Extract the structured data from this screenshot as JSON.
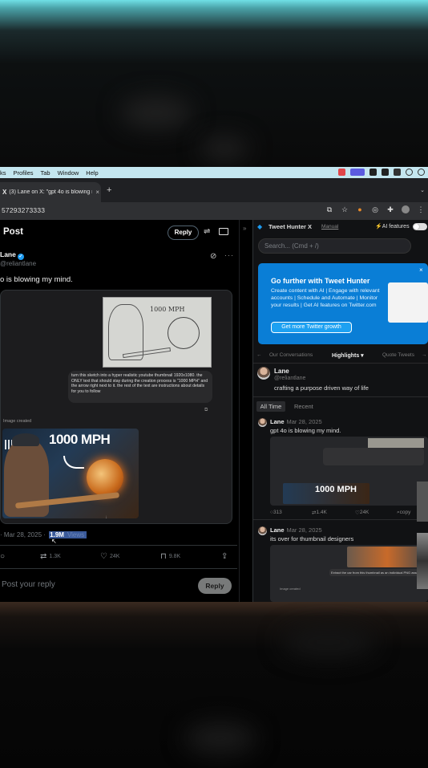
{
  "menubar": {
    "items": [
      "ks",
      "Profiles",
      "Tab",
      "Window",
      "Help"
    ]
  },
  "browser": {
    "tab_title": "(3) Lane on X: \"gpt 4o is blowing my mind\"",
    "tab_close": "×",
    "new_tab": "+",
    "url": "57293273333"
  },
  "post": {
    "header_title": "Post",
    "reply_pill": "Reply",
    "author_name": "Lane",
    "author_handle": "@reliantlane",
    "text": "o is blowing my mind.",
    "sketch_label": "1000 MPH",
    "prompt": "turn this sketch into a hyper realistic youtube thumbnail 1920x1080. the ONLY text that should stay during the creation process is \"1000 MPH\" and the arrow right next to it. the rest of the text are instructions about details for you to follow",
    "image_created": "Image created",
    "image_title": "1000 MPH",
    "date": "· Mar 28, 2025 ·",
    "views": "1.9M",
    "views_label": "Views",
    "actions": {
      "retweets": "1.3K",
      "likes": "24K",
      "bookmarks": "9.8K"
    },
    "reply_placeholder": "Post your reply",
    "reply_button": "Reply"
  },
  "sidebar": {
    "title": "Tweet Hunter X",
    "manual": "Manual",
    "ai_features": "AI features",
    "search_placeholder": "Search... (Cmd + /)",
    "promo": {
      "title": "Go further with Tweet Hunter",
      "text": "Create content with AI | Engage with relevant accounts | Schedule and Automate | Monitor your results | Get AI features on Twitter.com",
      "button": "Get more Twitter growth",
      "close": "×"
    },
    "tabs": [
      "Our Conversations",
      "Highlights ▾",
      "Quote Tweets"
    ],
    "profile": {
      "name": "Lane",
      "handle": "@reliantlane",
      "bio": "crafting a purpose driven way of life"
    },
    "filters": {
      "all_time": "All Time",
      "recent": "Recent"
    },
    "tweets": [
      {
        "name": "Lane",
        "date": "Mar 28, 2025",
        "text": "gpt 4o is blowing my mind.",
        "media_title": "1000 MPH",
        "replies": "313",
        "retweets": "1.4K",
        "likes": "24K",
        "copy": "copy"
      },
      {
        "name": "Lane",
        "date": "Mar 28, 2025",
        "text": "its over for thumbnail designers",
        "media_caption": "Extract the car from this thumbnail as an individual PNG asset",
        "image_created": "Image created"
      }
    ]
  },
  "colors": {
    "accent": "#1d9bf0",
    "promo_bg": "#0a7ed6",
    "menubar_bg": "#c4e6ef"
  }
}
